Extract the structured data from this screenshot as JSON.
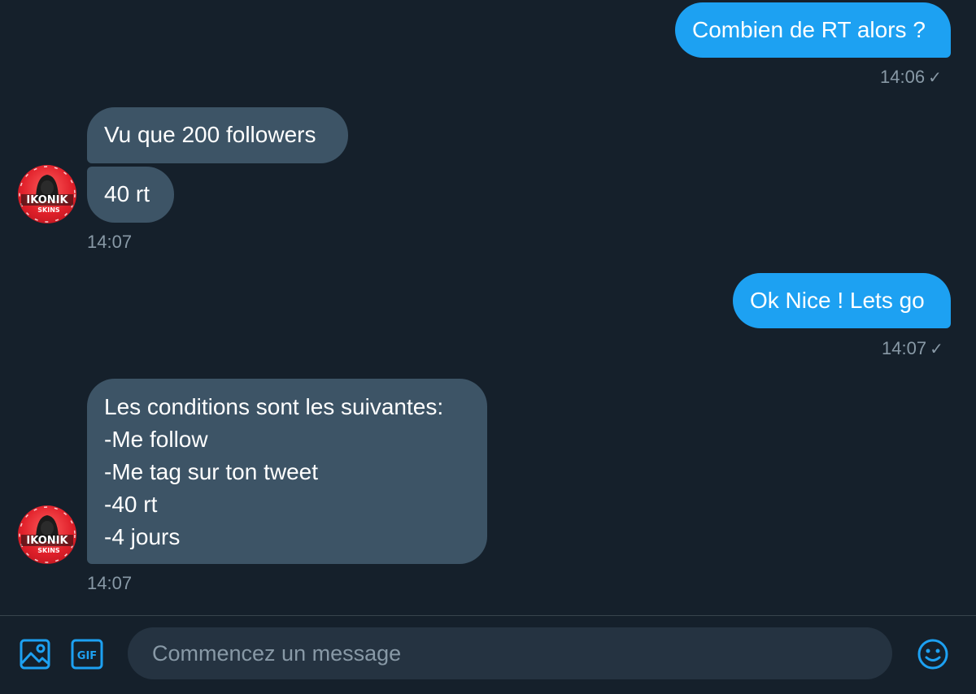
{
  "messages": {
    "m1": {
      "text": "Combien de RT alors ?",
      "time": "14:06",
      "status": "✓"
    },
    "m2": {
      "text": "Vu que 200 followers"
    },
    "m3": {
      "text": "40 rt",
      "time": "14:07"
    },
    "m4": {
      "text": "Ok Nice ! Lets go",
      "time": "14:07",
      "status": "✓"
    },
    "m5": {
      "lines": [
        "Les conditions sont les suivantes:",
        "-Me follow",
        "-Me tag sur ton tweet",
        "-40 rt",
        "-4 jours"
      ],
      "time": "14:07"
    }
  },
  "avatar": {
    "logo_top": "IKONIK",
    "logo_bottom": "SKINS"
  },
  "composer": {
    "placeholder": "Commencez un message",
    "gif_label": "GIF",
    "icons": [
      "image-icon",
      "gif-icon",
      "emoji-icon"
    ]
  },
  "colors": {
    "background": "#15202b",
    "outgoing_bubble": "#1da1f2",
    "incoming_bubble": "#3d5466",
    "accent": "#1da1f2",
    "muted_text": "#8899a6"
  }
}
